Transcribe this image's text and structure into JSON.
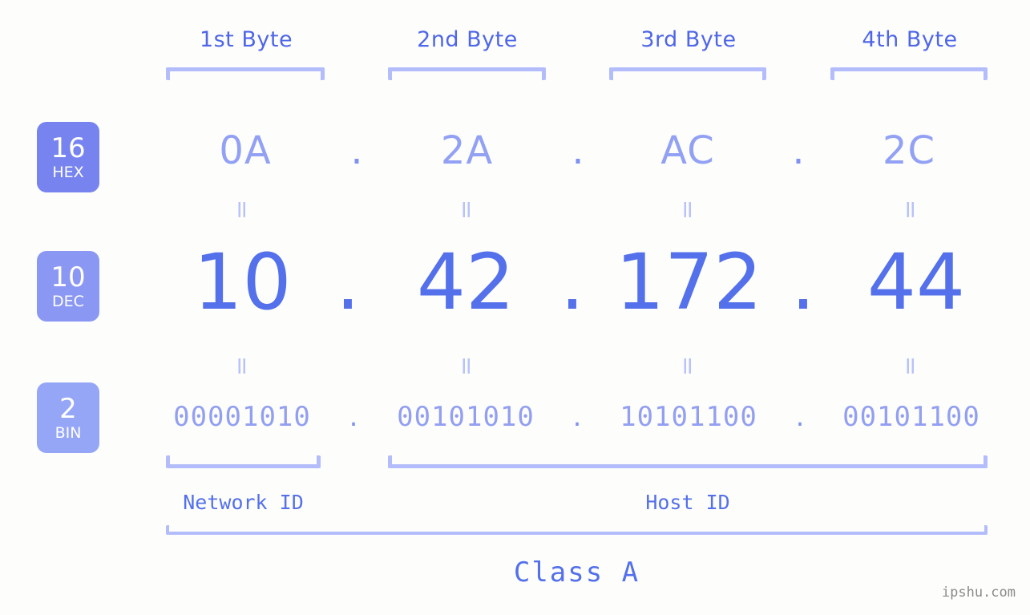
{
  "watermark": "ipshu.com",
  "byte_headers": [
    {
      "label": "1st Byte"
    },
    {
      "label": "2nd Byte"
    },
    {
      "label": "3rd Byte"
    },
    {
      "label": "4th Byte"
    }
  ],
  "radix_badges": [
    {
      "number": "16",
      "label": "HEX",
      "color": "#7784ef"
    },
    {
      "number": "10",
      "label": "DEC",
      "color": "#8b98f3"
    },
    {
      "number": "2",
      "label": "BIN",
      "color": "#96a6f7"
    }
  ],
  "rows": {
    "hex": {
      "radix": "16",
      "name": "HEX",
      "values": [
        "0A",
        "2A",
        "AC",
        "2C"
      ],
      "separator": "."
    },
    "dec": {
      "radix": "10",
      "name": "DEC",
      "values": [
        "10",
        "42",
        "172",
        "44"
      ],
      "separator": "."
    },
    "bin": {
      "radix": "2",
      "name": "BIN",
      "values": [
        "00001010",
        "00101010",
        "10101100",
        "00101100"
      ],
      "separator": "."
    }
  },
  "equals_symbol": "=",
  "ip_address": "10.42.172.44",
  "segments": {
    "network_id": "Network ID",
    "host_id": "Host ID",
    "class": "Class A"
  },
  "colors": {
    "background": "#fdfefb",
    "accent_strong": "#5470ea",
    "accent_mid": "#93a1f5",
    "accent_light": "#b3bdfb"
  }
}
